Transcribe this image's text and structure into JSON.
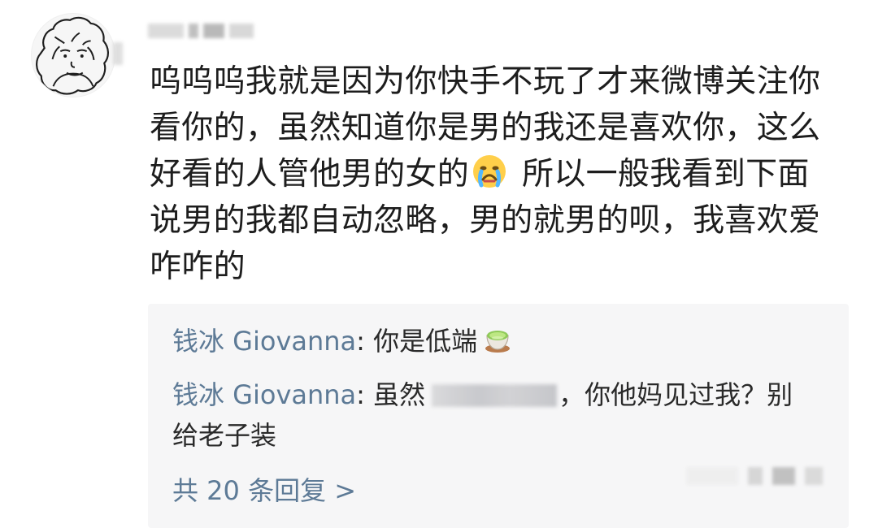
{
  "comment": {
    "text_before_emoji": "呜呜呜我就是因为你快手不玩了才来微博关注你看你的，虽然知道你是男的我还是喜欢你，这么好看的人管他男的女的",
    "text_after_emoji": "所以一般我看到下面说男的我都自动忽略，男的就男的呗，我喜欢爱咋咋的",
    "emoji_icon": "crying-face-icon"
  },
  "replies": [
    {
      "user": "钱冰 Giovanna",
      "separator": ":",
      "text": "你是低端",
      "emoji_icon": "tea-icon"
    },
    {
      "user": "钱冰 Giovanna",
      "separator": ":",
      "text_before": "虽然",
      "text_after": "，你他妈见过我？别给老子装"
    }
  ],
  "more_replies": {
    "label": "共 20 条回复 >"
  },
  "colors": {
    "reply_name": "#5d7a96",
    "reply_bg": "#f6f6f7",
    "body_text": "#1d1d1d"
  }
}
